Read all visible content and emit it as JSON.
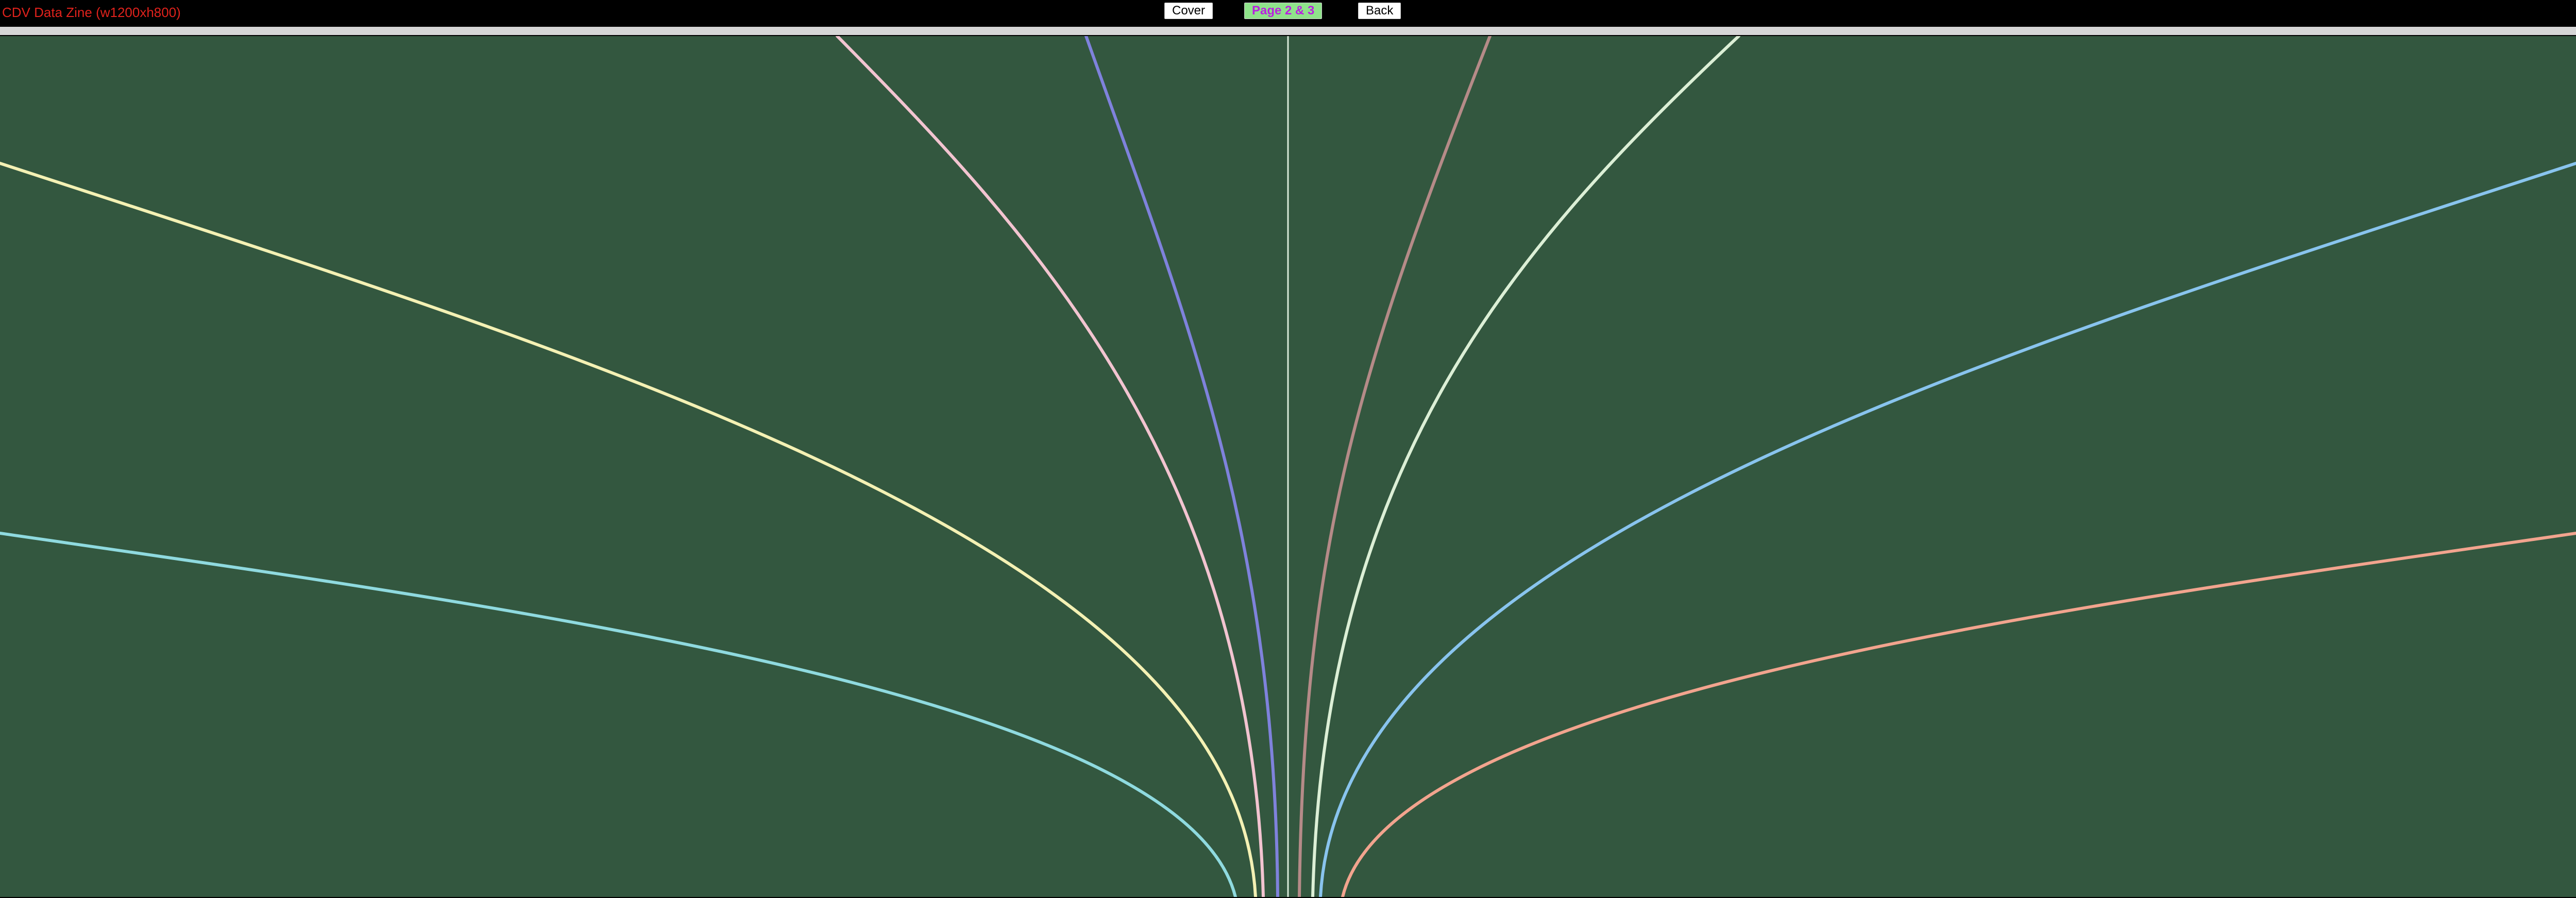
{
  "app": {
    "title": "CDV Data Zine (w1200xh800)"
  },
  "nav": {
    "cover_label": "Cover",
    "pages_label": "Page 2 & 3",
    "back_label": "Back"
  },
  "colors": {
    "title_text": "#e0221c",
    "canvas_bg": "#33573f",
    "divider": "#d6d6d6",
    "button_bg": "#ffffff",
    "button_text": "#000000",
    "active_button_bg": "#8fe38a",
    "active_button_text": "#b91fe0"
  },
  "visualization": {
    "curves": [
      {
        "id": "cyan-left",
        "color": "#8fdadf"
      },
      {
        "id": "yellow-left",
        "color": "#f4f1b4"
      },
      {
        "id": "pink-left",
        "color": "#f2c4d0"
      },
      {
        "id": "purple",
        "color": "#7f82dc"
      },
      {
        "id": "center-line",
        "color": "#d9ead9"
      },
      {
        "id": "mauve",
        "color": "#b58b88"
      },
      {
        "id": "mint",
        "color": "#dcefd6"
      },
      {
        "id": "blue-right",
        "color": "#89c4ee"
      },
      {
        "id": "salmon-right",
        "color": "#f2a48e"
      }
    ]
  }
}
